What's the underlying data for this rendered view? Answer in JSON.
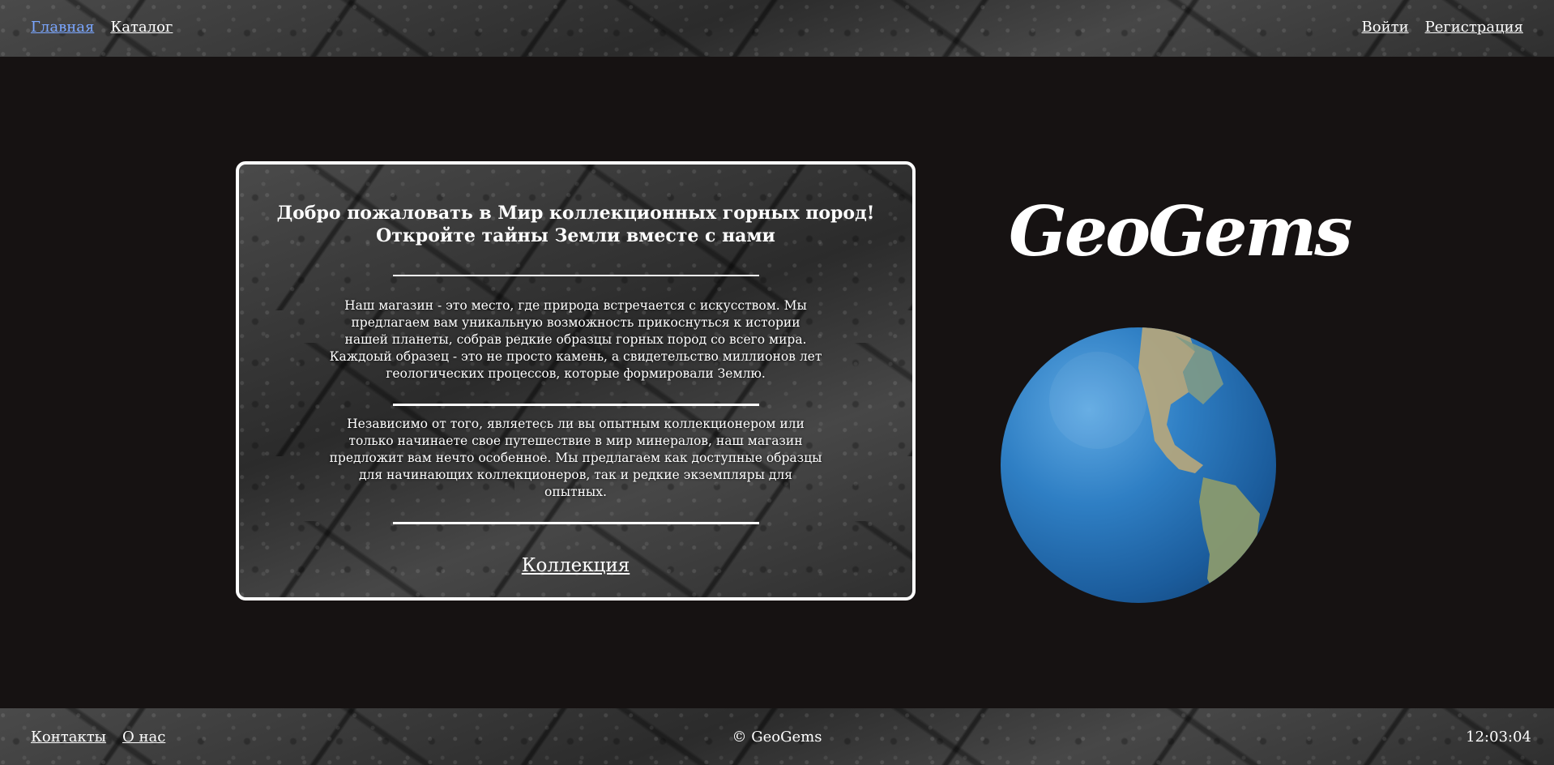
{
  "header": {
    "nav_left": [
      "Главная",
      "Каталог"
    ],
    "nav_right": [
      "Войти",
      "Регистрация"
    ],
    "active_color": "#7aa6ff"
  },
  "card": {
    "title_line1": "Добро пожаловать в Мир коллекционных горных пород!",
    "title_line2": "Откройте тайны Земли вместе с нами",
    "paragraph1": "Наш магазин - это место, где природа встречается с искусством. Мы предлагаем вам уникальную возможность прикоснуться к истории нашей планеты, собрав редкие образцы горных пород со всего мира. Каждоый образец - это не просто камень, а свидетельство миллионов лет геологических процессов, которые формировали Землю.",
    "paragraph2": "Независимо от того, являетесь ли вы опытным коллекционером или только начинаете свое путешествие в мир минералов, наш магазин предложит вам нечто особенное. Мы предлагаем как доступные образцы для начинающих коллекционеров, так и редкие экземпляры для опытных.",
    "link": "Коллекция"
  },
  "logo": {
    "text": "GeoGems"
  },
  "globe": {
    "icon": "earth-globe-icon"
  },
  "footer": {
    "links": [
      "Контакты",
      "О нас"
    ],
    "copyright": "© GeoGems",
    "clock": "12:03:04"
  },
  "colors": {
    "page_background": "#161212",
    "text": "#ffffff"
  }
}
